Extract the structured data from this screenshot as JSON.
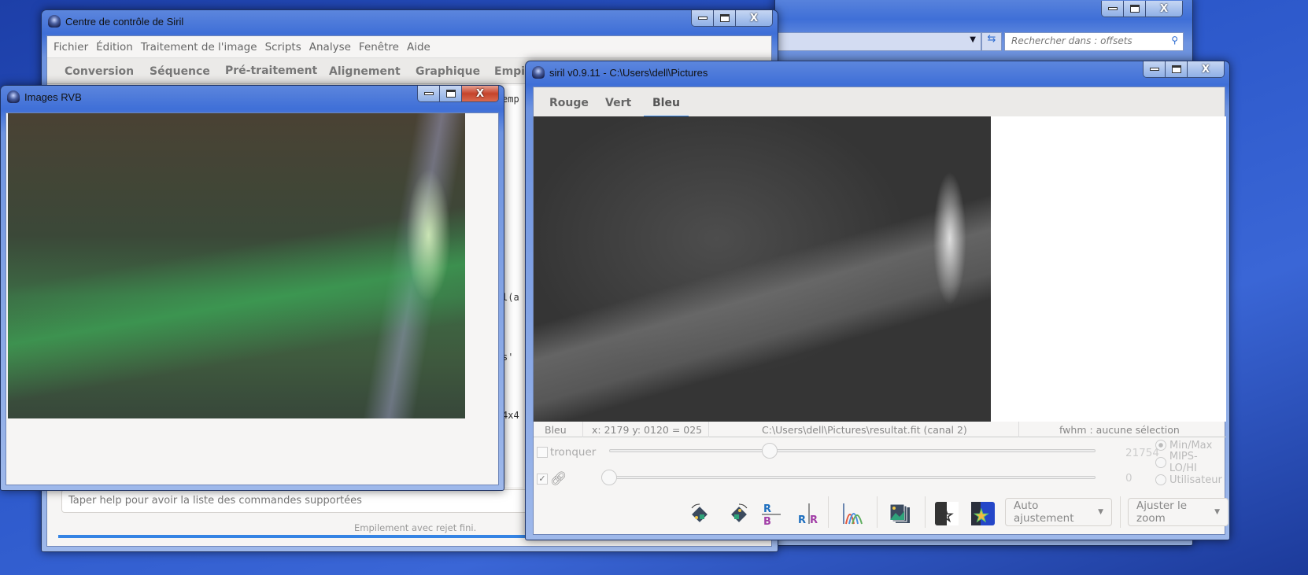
{
  "explorer": {
    "search_placeholder": "Rechercher dans : offsets"
  },
  "control_center": {
    "title": "Centre de contrôle de Siril",
    "menu": [
      "Fichier",
      "Édition",
      "Traitement de l'image",
      "Scripts",
      "Analyse",
      "Fenêtre",
      "Aide"
    ],
    "tabs": [
      "Conversion",
      "Séquence",
      "Pré-traitement",
      "Alignement",
      "Graphique",
      "Empile"
    ],
    "log_fragments": [
      "emp",
      "l(a",
      "s'",
      "4x4"
    ],
    "command_placeholder": "Taper help pour avoir la liste des commandes supportées",
    "status": "Empilement avec rejet fini.",
    "progress": 100
  },
  "rgb_window": {
    "title": "Images RVB"
  },
  "siril_window": {
    "title": "siril v0.9.11 - C:\\Users\\dell\\Pictures",
    "tabs": [
      "Rouge",
      "Vert",
      "Bleu"
    ],
    "active_tab": "Bleu",
    "statusbar": {
      "channel": "Bleu",
      "coords": "x: 2179 y: 0120 = 025",
      "file": "C:\\Users\\dell\\Pictures\\resultat.fit (canal 2)",
      "fwhm": "fwhm : aucune sélection"
    },
    "tronquer_label": "tronquer",
    "high_value": "21754",
    "low_value": "0",
    "high_slider_fraction": 0.33,
    "low_slider_fraction": 0.0,
    "scale_modes": [
      "Min/Max",
      "MIPS-LO/HI",
      "Utilisateur"
    ],
    "selected_mode": "Min/Max",
    "auto_button": "Auto ajustement",
    "zoom_button": "Ajuster le zoom"
  }
}
